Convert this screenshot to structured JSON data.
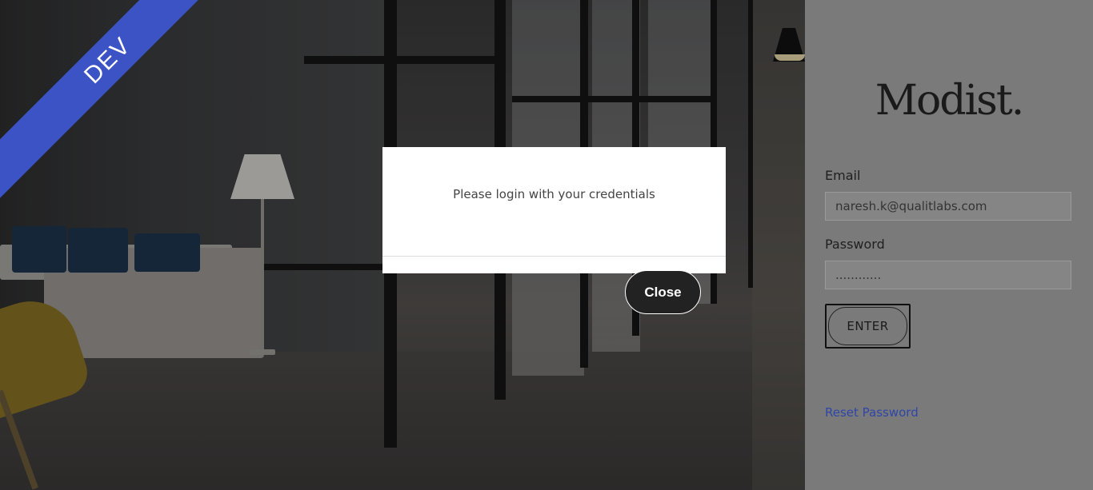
{
  "ribbon": {
    "label": "DEV",
    "color": "#3b53c4"
  },
  "brand": {
    "logo_text": "Modist."
  },
  "login": {
    "email_label": "Email",
    "email_value": "naresh.k@qualitlabs.com",
    "password_label": "Password",
    "password_value": "............",
    "enter_label": "ENTER",
    "reset_label": "Reset Password"
  },
  "modal": {
    "message": "Please login with your credentials",
    "close_label": "Close"
  },
  "colors": {
    "link": "#2f46a8",
    "close_button_bg": "#222222",
    "modal_bg": "#ffffff"
  }
}
